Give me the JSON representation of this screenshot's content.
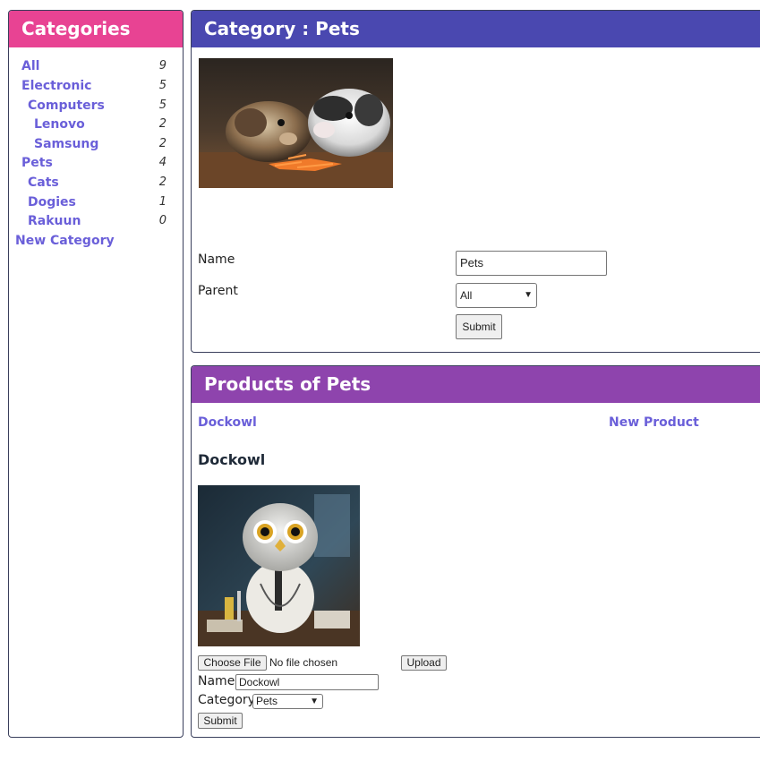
{
  "sidebar": {
    "title": "Categories",
    "items": [
      {
        "label": "All",
        "count": "9"
      },
      {
        "label": "Electronic",
        "count": "5"
      },
      {
        "label": "Computers",
        "count": "5"
      },
      {
        "label": "Lenovo",
        "count": "2"
      },
      {
        "label": "Samsung",
        "count": "2"
      },
      {
        "label": "Pets",
        "count": "4"
      },
      {
        "label": "Cats",
        "count": "2"
      },
      {
        "label": "Dogies",
        "count": "1"
      },
      {
        "label": "Rakuun",
        "count": "0"
      }
    ],
    "new_category": "New Category"
  },
  "category": {
    "title": "Category : Pets",
    "image_alt": "guinea-pigs",
    "name_label": "Name",
    "name_value": "Pets",
    "parent_label": "Parent",
    "parent_value": "All",
    "submit_label": "Submit"
  },
  "products": {
    "title": "Products of Pets",
    "list": [
      "Dockowl"
    ],
    "new_product": "New Product",
    "selected": {
      "heading": "Dockowl",
      "choose_file": "Choose File",
      "no_file": "No file chosen",
      "upload": "Upload",
      "name_label": "Name",
      "name_value": "Dockowl",
      "category_label": "Category",
      "category_value": "Pets",
      "submit_label": "Submit"
    }
  },
  "colors": {
    "sidebar_header": "#e84393",
    "category_header": "#4a48b0",
    "products_header": "#8e44ad",
    "link": "#6a5fd9"
  }
}
